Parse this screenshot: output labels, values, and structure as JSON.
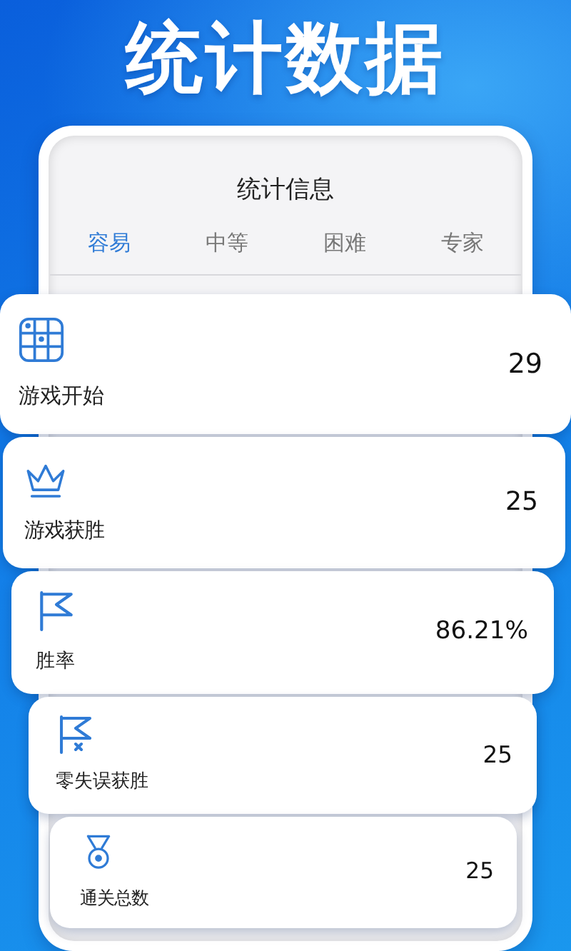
{
  "banner": {
    "title": "统计数据"
  },
  "screen": {
    "title": "统计信息",
    "tabs": [
      {
        "label": "容易",
        "selected": true
      },
      {
        "label": "中等",
        "selected": false
      },
      {
        "label": "困难",
        "selected": false
      },
      {
        "label": "专家",
        "selected": false
      }
    ]
  },
  "stats": [
    {
      "label": "游戏开始",
      "value": "29"
    },
    {
      "label": "游戏获胜",
      "value": "25"
    },
    {
      "label": "胜率",
      "value": "86.21%"
    },
    {
      "label": "零失误获胜",
      "value": "25"
    },
    {
      "label": "通关总数",
      "value": "25"
    }
  ]
}
